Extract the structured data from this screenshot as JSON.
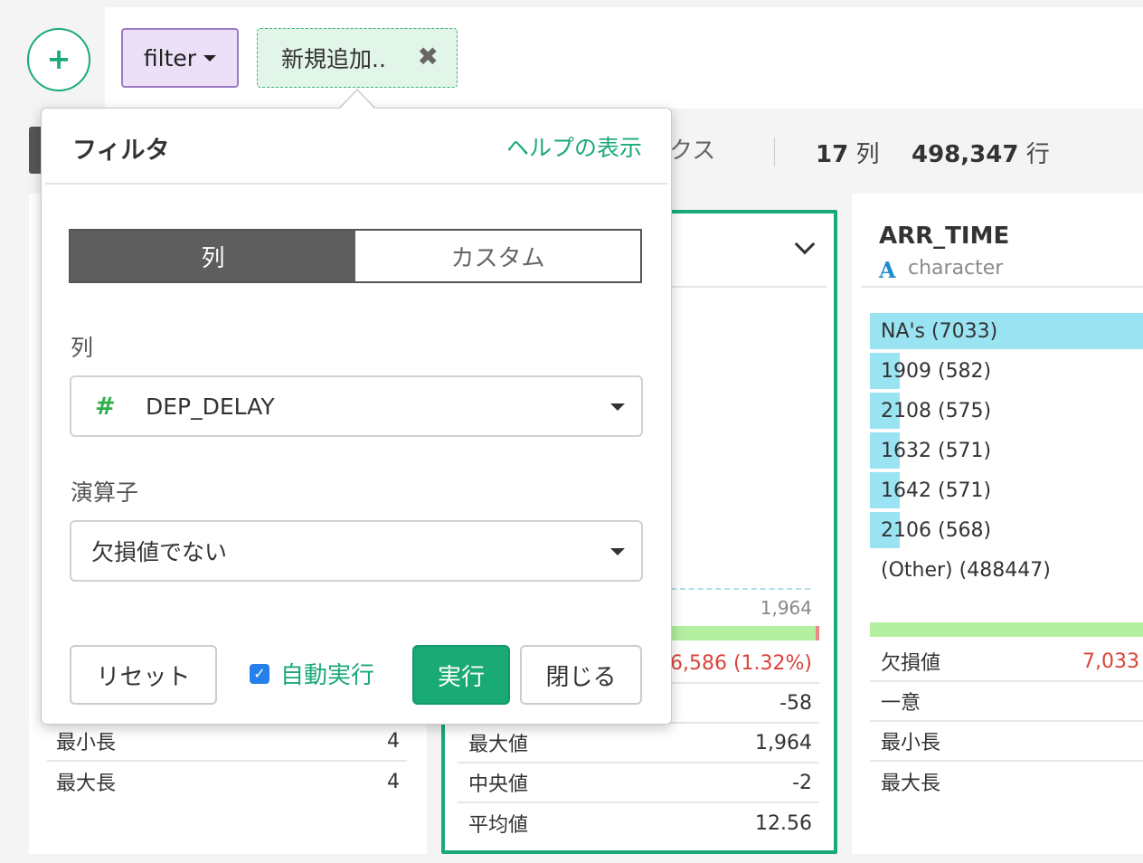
{
  "toolbar": {
    "add_icon": "plus-icon",
    "filter_label": "filter",
    "new_chip_label": "新規追加..",
    "new_chip_close": "✖"
  },
  "header": {
    "partial_text": "クス",
    "col_count": "17",
    "col_unit": "列",
    "row_count": "498,347",
    "row_unit": "行"
  },
  "popup": {
    "title": "フィルタ",
    "help_link": "ヘルプの表示",
    "tabs": [
      "列",
      "カスタム"
    ],
    "column_label": "列",
    "column_type_icon": "#",
    "column_value": "DEP_DELAY",
    "operator_label": "演算子",
    "operator_value": "欠損値でない",
    "reset_label": "リセット",
    "auto_run_label": "自動実行",
    "auto_run_checked": true,
    "run_label": "実行",
    "close_label": "閉じる"
  },
  "card1": {
    "stats": [
      {
        "label": "最小長",
        "value": "4"
      },
      {
        "label": "最大長",
        "value": "4"
      }
    ]
  },
  "card2": {
    "max_axis_label": "1,964",
    "stats": [
      {
        "label": "",
        "value": "6,586 (1.32%)"
      },
      {
        "label": "",
        "value": "-58"
      },
      {
        "label": "最大値",
        "value": "1,964"
      },
      {
        "label": "中央値",
        "value": "-2"
      },
      {
        "label": "平均値",
        "value": "12.56"
      }
    ]
  },
  "card3": {
    "title": "ARR_TIME",
    "type_icon": "A",
    "type": "character",
    "bars": [
      {
        "label": "NA's (7033)",
        "fraction": 1.0
      },
      {
        "label": "1909 (582)",
        "fraction": 0.11
      },
      {
        "label": "2108 (575)",
        "fraction": 0.11
      },
      {
        "label": "1632 (571)",
        "fraction": 0.11
      },
      {
        "label": "1642 (571)",
        "fraction": 0.11
      },
      {
        "label": "2106 (568)",
        "fraction": 0.11
      },
      {
        "label": "(Other) (488447)",
        "fraction": 0
      }
    ],
    "stats": [
      {
        "label": "欠損値",
        "value": "7,033"
      },
      {
        "label": "一意",
        "value": ""
      },
      {
        "label": "最小長",
        "value": ""
      },
      {
        "label": "最大長",
        "value": ""
      }
    ]
  },
  "colors": {
    "accent": "#1aaa76",
    "filter_bg": "#ebe0f7",
    "bar_fill": "#99e3f2",
    "missing_red": "#d9443a",
    "checkbox_blue": "#2680eb"
  }
}
